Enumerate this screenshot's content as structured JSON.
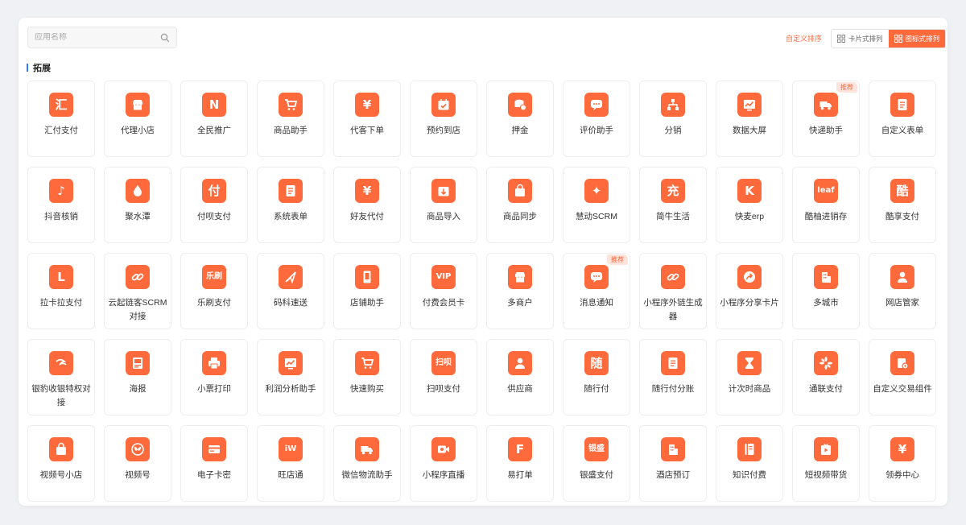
{
  "search": {
    "placeholder": "应用名称",
    "value": ""
  },
  "toolbar": {
    "custom_sort_label": "自定义排序",
    "card_view_label": "卡片式排列",
    "icon_view_label": "图标式排列",
    "active_view": "icon"
  },
  "section": {
    "title": "拓展"
  },
  "colors": {
    "accent": "#ff6a3d",
    "section_bar": "#2b7bff"
  },
  "apps": [
    {
      "label": "汇付支付",
      "icon": "汇"
    },
    {
      "label": "代理小店",
      "icon": "store"
    },
    {
      "label": "全民推广",
      "icon": "N"
    },
    {
      "label": "商品助手",
      "icon": "cart"
    },
    {
      "label": "代客下单",
      "icon": "¥"
    },
    {
      "label": "预约到店",
      "icon": "calendar"
    },
    {
      "label": "押金",
      "icon": "coins"
    },
    {
      "label": "评价助手",
      "icon": "chat"
    },
    {
      "label": "分销",
      "icon": "tree"
    },
    {
      "label": "数据大屏",
      "icon": "chart"
    },
    {
      "label": "快递助手",
      "icon": "truck",
      "badge": "推荐"
    },
    {
      "label": "自定义表单",
      "icon": "form"
    },
    {
      "label": "抖音核销",
      "icon": "♪"
    },
    {
      "label": "聚水潭",
      "icon": "drop"
    },
    {
      "label": "付呗支付",
      "icon": "付"
    },
    {
      "label": "系统表单",
      "icon": "form"
    },
    {
      "label": "好友代付",
      "icon": "¥"
    },
    {
      "label": "商品导入",
      "icon": "import"
    },
    {
      "label": "商品同步",
      "icon": "bag"
    },
    {
      "label": "慧动SCRM",
      "icon": "✦"
    },
    {
      "label": "简牛生活",
      "icon": "充"
    },
    {
      "label": "快麦erp",
      "icon": "K"
    },
    {
      "label": "酷柚进销存",
      "icon": "leaf"
    },
    {
      "label": "酷享支付",
      "icon": "酷"
    },
    {
      "label": "拉卡拉支付",
      "icon": "L"
    },
    {
      "label": "云起链客SCRM对接",
      "icon": "link"
    },
    {
      "label": "乐刷支付",
      "icon": "乐刷"
    },
    {
      "label": "码科速送",
      "icon": "send"
    },
    {
      "label": "店铺助手",
      "icon": "phone"
    },
    {
      "label": "付费会员卡",
      "icon": "VIP"
    },
    {
      "label": "多商户",
      "icon": "store"
    },
    {
      "label": "消息通知",
      "icon": "chat",
      "badge": "推荐"
    },
    {
      "label": "小程序外链生成器",
      "icon": "link"
    },
    {
      "label": "小程序分享卡片",
      "icon": "share"
    },
    {
      "label": "多城市",
      "icon": "building"
    },
    {
      "label": "网店管家",
      "icon": "user"
    },
    {
      "label": "银豹收银特权对接",
      "icon": "wave"
    },
    {
      "label": "海报",
      "icon": "poster"
    },
    {
      "label": "小票打印",
      "icon": "print"
    },
    {
      "label": "利润分析助手",
      "icon": "chart"
    },
    {
      "label": "快速购买",
      "icon": "cart"
    },
    {
      "label": "扫呗支付",
      "icon": "扫呗"
    },
    {
      "label": "供应商",
      "icon": "user"
    },
    {
      "label": "随行付",
      "icon": "随"
    },
    {
      "label": "随行付分账",
      "icon": "form"
    },
    {
      "label": "计次时商品",
      "icon": "hourglass"
    },
    {
      "label": "通联支付",
      "icon": "flower"
    },
    {
      "label": "自定义交易组件",
      "icon": "gear"
    },
    {
      "label": "视频号小店",
      "icon": "bag"
    },
    {
      "label": "视频号",
      "icon": "butterfly"
    },
    {
      "label": "电子卡密",
      "icon": "card"
    },
    {
      "label": "旺店通",
      "icon": "iW"
    },
    {
      "label": "微信物流助手",
      "icon": "truck"
    },
    {
      "label": "小程序直播",
      "icon": "camera"
    },
    {
      "label": "易打单",
      "icon": "F"
    },
    {
      "label": "银盛支付",
      "icon": "银盛"
    },
    {
      "label": "酒店预订",
      "icon": "building"
    },
    {
      "label": "知识付费",
      "icon": "book"
    },
    {
      "label": "短视频带货",
      "icon": "play"
    },
    {
      "label": "领券中心",
      "icon": "¥"
    }
  ]
}
